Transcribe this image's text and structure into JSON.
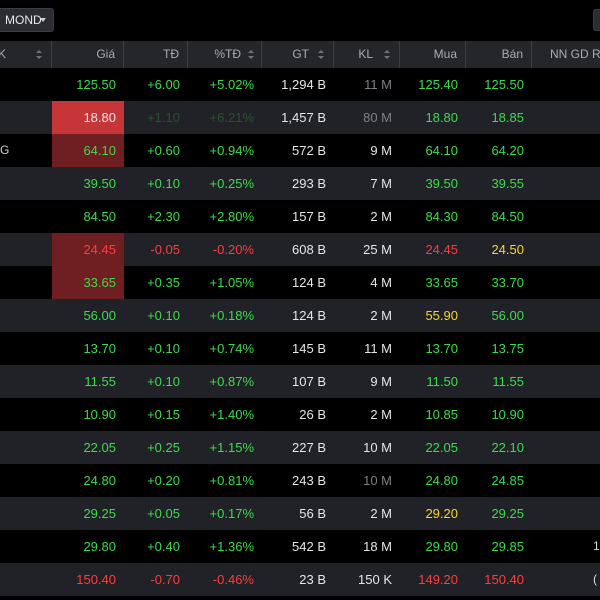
{
  "toolbar": {
    "dropdown_label": "MOND"
  },
  "columns": {
    "first": "K",
    "gia": "Giá",
    "td": "TĐ",
    "pct": "%TĐ",
    "gt": "GT",
    "kl": "KL",
    "mua": "Mua",
    "ban": "Bán",
    "nn": "NN GD Rò"
  },
  "colors": {
    "up": "#3ddc4b",
    "down": "#ff3c3c",
    "ref": "#f4d53a",
    "highlight": "#c63638"
  },
  "rows": [
    {
      "gia": "125.50",
      "td": "+6.00",
      "pct": "+5.02%",
      "gt": "1,294 B",
      "kl": "11 M",
      "mua": "125.40",
      "ban": "125.50"
    },
    {
      "gia": "18.80",
      "td": "+1.10",
      "pct": "+6.21%",
      "gt": "1,457 B",
      "kl": "80 M",
      "mua": "18.80",
      "ban": "18.85"
    },
    {
      "gia": "64.10",
      "td": "+0.60",
      "pct": "+0.94%",
      "gt": "572 B",
      "kl": "9 M",
      "mua": "64.10",
      "ban": "64.20"
    },
    {
      "gia": "39.50",
      "td": "+0.10",
      "pct": "+0.25%",
      "gt": "293 B",
      "kl": "7 M",
      "mua": "39.50",
      "ban": "39.55"
    },
    {
      "gia": "84.50",
      "td": "+2.30",
      "pct": "+2.80%",
      "gt": "157 B",
      "kl": "2 M",
      "mua": "84.30",
      "ban": "84.50"
    },
    {
      "gia": "24.45",
      "td": "-0.05",
      "pct": "-0.20%",
      "gt": "608 B",
      "kl": "25 M",
      "mua": "24.45",
      "ban": "24.50"
    },
    {
      "gia": "33.65",
      "td": "+0.35",
      "pct": "+1.05%",
      "gt": "124 B",
      "kl": "4 M",
      "mua": "33.65",
      "ban": "33.70"
    },
    {
      "gia": "56.00",
      "td": "+0.10",
      "pct": "+0.18%",
      "gt": "124 B",
      "kl": "2 M",
      "mua": "55.90",
      "ban": "56.00"
    },
    {
      "gia": "13.70",
      "td": "+0.10",
      "pct": "+0.74%",
      "gt": "145 B",
      "kl": "11 M",
      "mua": "13.70",
      "ban": "13.75"
    },
    {
      "gia": "11.55",
      "td": "+0.10",
      "pct": "+0.87%",
      "gt": "107 B",
      "kl": "9 M",
      "mua": "11.50",
      "ban": "11.55"
    },
    {
      "gia": "10.90",
      "td": "+0.15",
      "pct": "+1.40%",
      "gt": "26 B",
      "kl": "2 M",
      "mua": "10.85",
      "ban": "10.90"
    },
    {
      "gia": "22.05",
      "td": "+0.25",
      "pct": "+1.15%",
      "gt": "227 B",
      "kl": "10 M",
      "mua": "22.05",
      "ban": "22.10"
    },
    {
      "gia": "24.80",
      "td": "+0.20",
      "pct": "+0.81%",
      "gt": "243 B",
      "kl": "10 M",
      "mua": "24.80",
      "ban": "24.85"
    },
    {
      "gia": "29.25",
      "td": "+0.05",
      "pct": "+0.17%",
      "gt": "56 B",
      "kl": "2 M",
      "mua": "29.20",
      "ban": "29.25"
    },
    {
      "gia": "29.80",
      "td": "+0.40",
      "pct": "+1.36%",
      "gt": "542 B",
      "kl": "18 M",
      "mua": "29.80",
      "ban": "29.85"
    },
    {
      "gia": "150.40",
      "td": "-0.70",
      "pct": "-0.46%",
      "gt": "23 B",
      "kl": "150 K",
      "mua": "149.20",
      "ban": "150.40"
    }
  ]
}
